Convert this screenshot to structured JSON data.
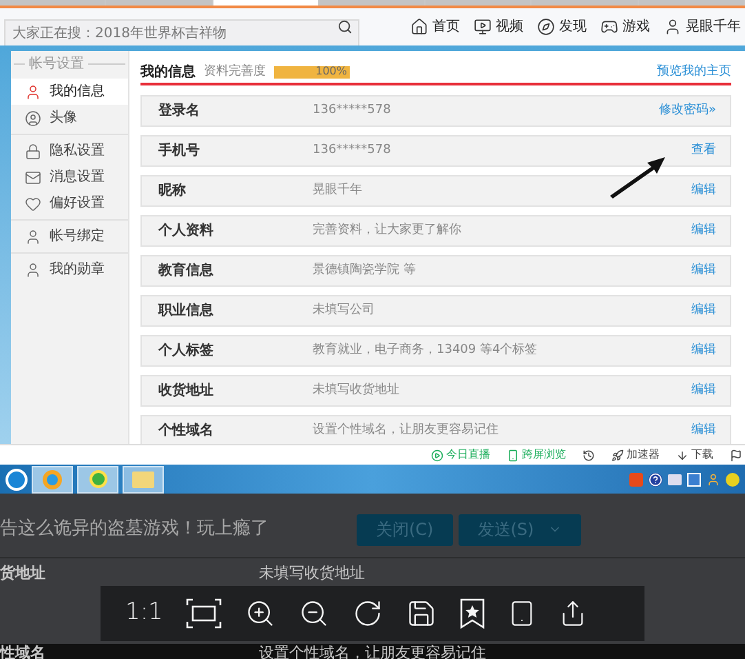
{
  "browser_tabs": [
    {
      "selected": false
    },
    {
      "selected": false
    },
    {
      "selected": true
    },
    {
      "selected": false
    },
    {
      "selected": false
    },
    {
      "selected": false
    },
    {
      "selected": false
    }
  ],
  "toolbar": {
    "search": {
      "placeholder": "大家正在搜：2018年世界杯吉祥物"
    },
    "nav": [
      {
        "label": "首页",
        "kind": "home"
      },
      {
        "label": "视频",
        "kind": "video"
      },
      {
        "label": "发现",
        "kind": "discover"
      },
      {
        "label": "游戏",
        "kind": "game"
      },
      {
        "label": "晃眼千年",
        "kind": "user"
      }
    ]
  },
  "sidebar": {
    "heading": "帐号设置",
    "groups": [
      {
        "items": [
          {
            "label": "我的信息",
            "kind": "info",
            "selected": true
          },
          {
            "label": "头像",
            "kind": "avatar",
            "selected": false
          }
        ]
      },
      {
        "items": [
          {
            "label": "隐私设置",
            "kind": "lock",
            "selected": false
          },
          {
            "label": "消息设置",
            "kind": "mail",
            "selected": false
          },
          {
            "label": "偏好设置",
            "kind": "heart",
            "selected": false
          }
        ]
      },
      {
        "items": [
          {
            "label": "帐号绑定",
            "kind": "user",
            "selected": false
          }
        ]
      },
      {
        "items": [
          {
            "label": "我的勋章",
            "kind": "user",
            "selected": false
          }
        ]
      }
    ]
  },
  "profile": {
    "title": "我的信息",
    "completeness_label": "资料完善度",
    "completeness": {
      "level": 1,
      "reading": "100%"
    },
    "preview_link": "预览我的主页",
    "rows": [
      {
        "label": "登录名",
        "value": "136*****578",
        "action": "修改密码»"
      },
      {
        "label": "手机号",
        "value": "136*****578",
        "action": "查看"
      },
      {
        "label": "昵称",
        "value": "晃眼千年",
        "action": "编辑"
      },
      {
        "label": "个人资料",
        "value": "完善资料，让大家更了解你",
        "action": "编辑"
      },
      {
        "label": "教育信息",
        "value": "景德镇陶瓷学院 等",
        "action": "编辑"
      },
      {
        "label": "职业信息",
        "value": "未填写公司",
        "action": "编辑"
      },
      {
        "label": "个人标签",
        "value": "教育就业，电子商务，13409 等4个标签",
        "action": "编辑"
      },
      {
        "label": "收货地址",
        "value": "未填写收货地址",
        "action": "编辑"
      },
      {
        "label": "个性域名",
        "value": "设置个性域名，让朋友更容易记住",
        "action": "编辑"
      }
    ]
  },
  "status_bar": [
    {
      "label": "今日直播",
      "kind": "live"
    },
    {
      "label": "跨屏浏览",
      "kind": "phone"
    },
    {
      "kind": "history"
    },
    {
      "label": "加速器",
      "kind": "speed"
    },
    {
      "label": "下载",
      "kind": "download"
    }
  ],
  "background_app": {
    "message": "告这么诡异的盗墓游戏！玩上瘾了",
    "buttons": [
      {
        "label": "关闭(C)",
        "dropdown": false
      },
      {
        "label": "发送(S)",
        "dropdown": true
      }
    ],
    "rows": [
      {
        "label": "货地址",
        "value": "未填写收货地址"
      },
      {
        "label": "性域名",
        "value": "设置个性域名，让朋友更容易记住"
      }
    ]
  },
  "viewer_toolbar": {
    "actual_size": "1:1"
  }
}
